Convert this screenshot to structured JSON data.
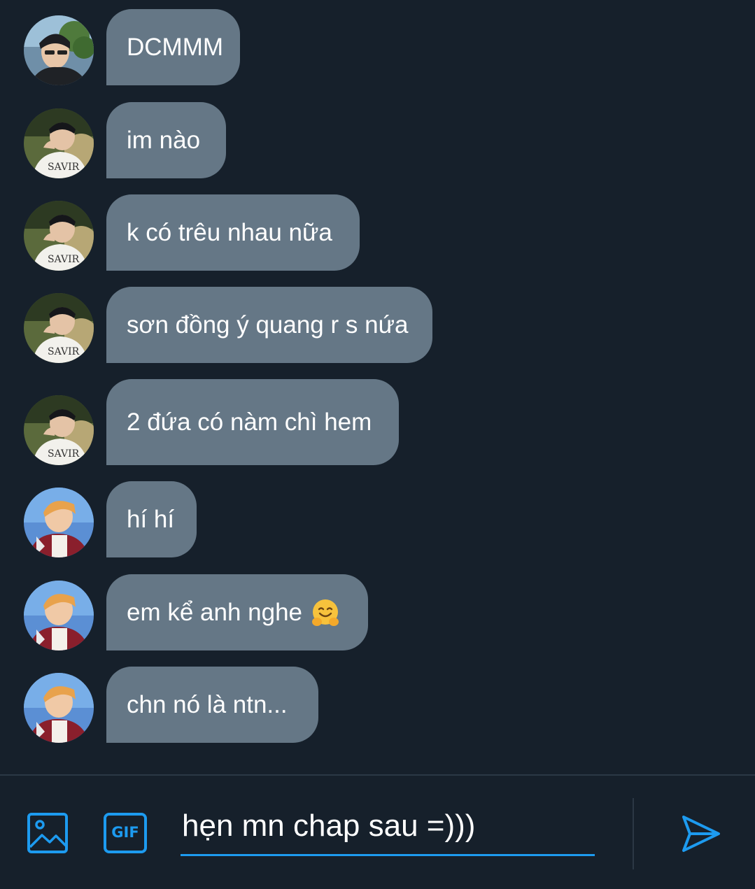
{
  "messages": [
    {
      "text": "DCMMM",
      "avatar": "avatar-1"
    },
    {
      "text": "im nào",
      "avatar": "avatar-2"
    },
    {
      "text": "k có trêu nhau nữa",
      "avatar": "avatar-2"
    },
    {
      "text": "sơn đồng ý quang r s nứa",
      "avatar": "avatar-2"
    },
    {
      "text": "2 đứa có nàm chì hem",
      "avatar": "avatar-2"
    },
    {
      "text": "hí hí",
      "avatar": "avatar-3"
    },
    {
      "text": "em kể anh nghe",
      "avatar": "avatar-3",
      "emoji": "hugging-face-emoji"
    },
    {
      "text": "chn nó là ntn...",
      "avatar": "avatar-3"
    }
  ],
  "composer": {
    "draft": "hẹn mn chap sau =)))",
    "gif_label": "GIF",
    "image_icon": "image-icon",
    "send_icon": "send-icon"
  },
  "colors": {
    "background": "#16202b",
    "bubble": "#657786",
    "accent": "#1d9bf0"
  }
}
